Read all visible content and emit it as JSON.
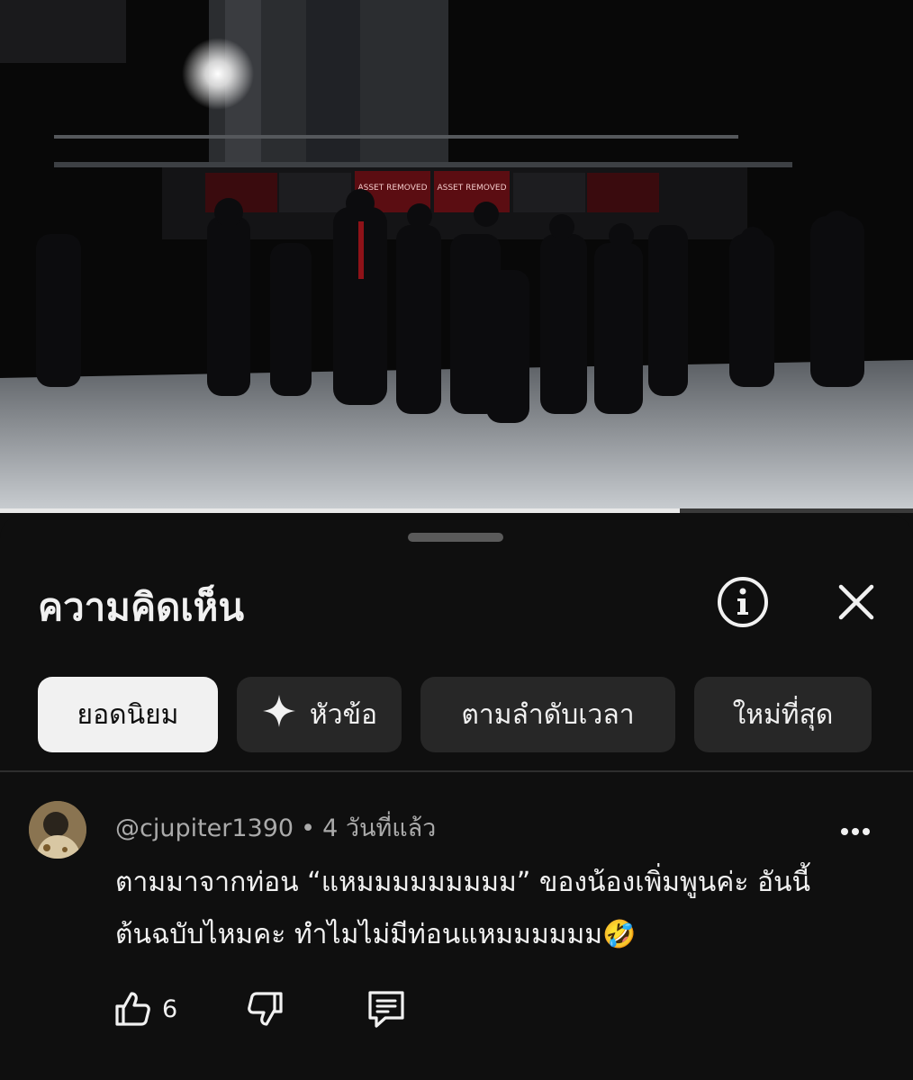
{
  "video": {
    "screen_labels": [
      "ASSET REMOVED",
      "ASSET REMOVED"
    ],
    "progress_fraction": 0.745
  },
  "sheet": {
    "title": "ความคิดเห็น",
    "info_icon": "info-circle-icon",
    "close_icon": "close-icon"
  },
  "chips": [
    {
      "label": "ยอดนิยม",
      "active": true
    },
    {
      "label": "หัวข้อ",
      "icon": "sparkle-icon"
    },
    {
      "label": "ตามลำดับเวลา"
    },
    {
      "label": "ใหม่ที่สุด"
    }
  ],
  "comment": {
    "author": "@cjupiter1390",
    "separator": "•",
    "time": "4 วันที่แล้ว",
    "text": "ตามมาจากท่อน “แหมมมมมมมมม” ของน้องเพิ่มพูนค่ะ อันนี้ต้นฉบับไหมคะ ทำไมไม่มีท่อนแหมมมมมม🤣",
    "likes": "6"
  },
  "colors": {
    "background": "#0f0f0f",
    "chip_bg": "#272727",
    "chip_active_bg": "#f1f1f1",
    "meta_text": "#aaaaaa"
  }
}
